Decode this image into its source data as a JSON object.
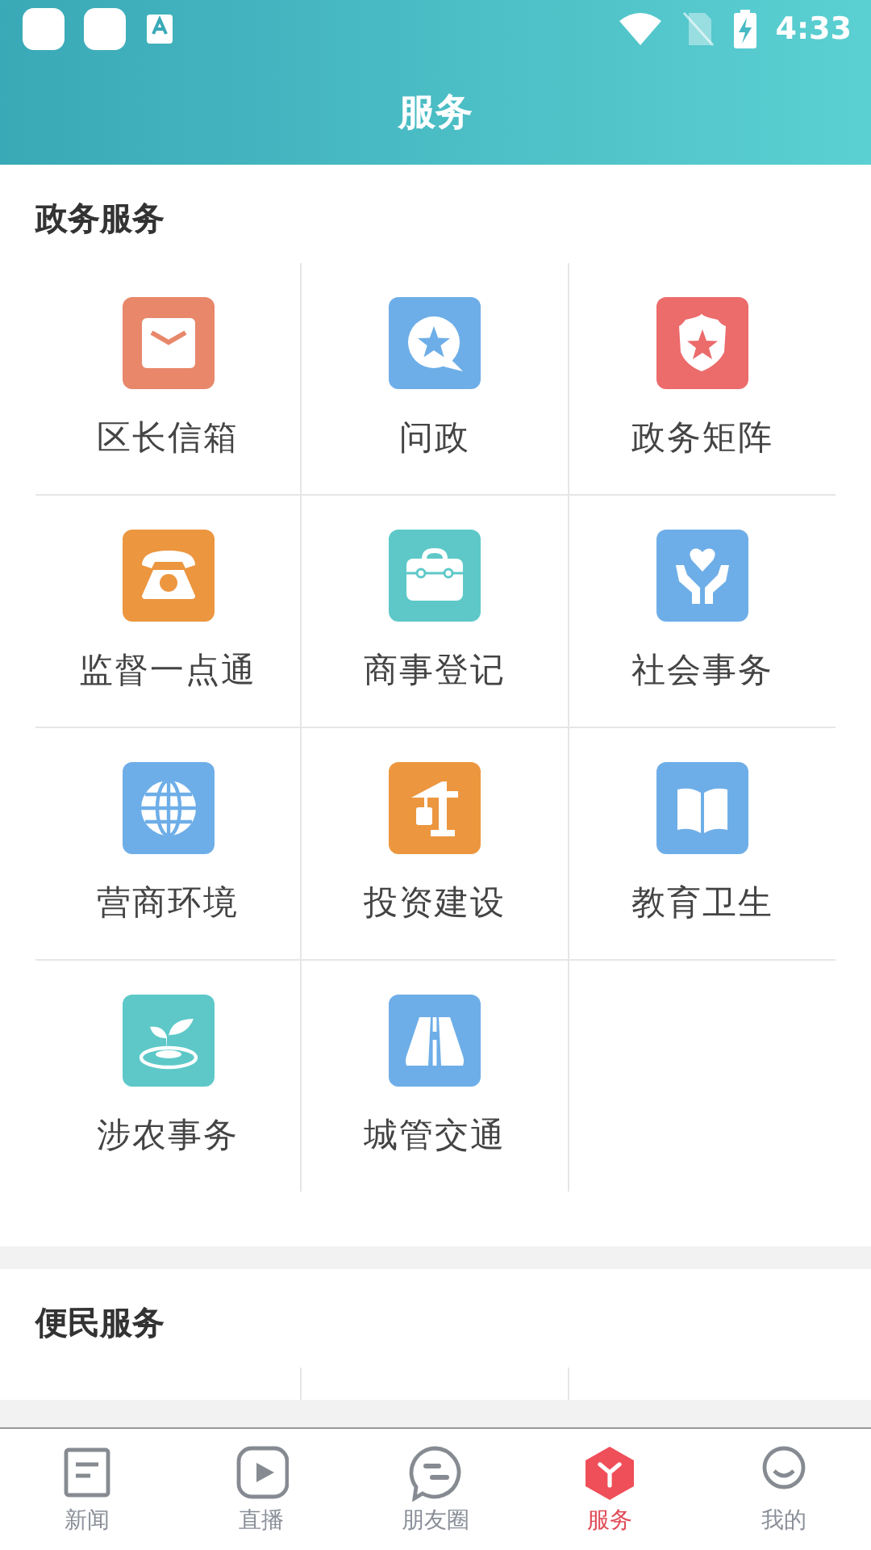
{
  "status_bar": {
    "time": "4:33"
  },
  "header": {
    "title": "服务"
  },
  "sections": [
    {
      "title": "政务服务",
      "items": [
        {
          "label": "区长信箱",
          "color": "#e8876a"
        },
        {
          "label": "问政",
          "color": "#6eaee8"
        },
        {
          "label": "政务矩阵",
          "color": "#ec6b6b"
        },
        {
          "label": "监督一点通",
          "color": "#ec963f"
        },
        {
          "label": "商事登记",
          "color": "#5ec8c8"
        },
        {
          "label": "社会事务",
          "color": "#6eaee8"
        },
        {
          "label": "营商环境",
          "color": "#6eaee8"
        },
        {
          "label": "投资建设",
          "color": "#ec963f"
        },
        {
          "label": "教育卫生",
          "color": "#6eaee8"
        },
        {
          "label": "涉农事务",
          "color": "#5ec8c8"
        },
        {
          "label": "城管交通",
          "color": "#6eaee8"
        }
      ]
    },
    {
      "title": "便民服务"
    }
  ],
  "nav": [
    {
      "label": "新闻",
      "selected": false
    },
    {
      "label": "直播",
      "selected": false
    },
    {
      "label": "朋友圈",
      "selected": false
    },
    {
      "label": "服务",
      "selected": true
    },
    {
      "label": "我的",
      "selected": false
    }
  ]
}
